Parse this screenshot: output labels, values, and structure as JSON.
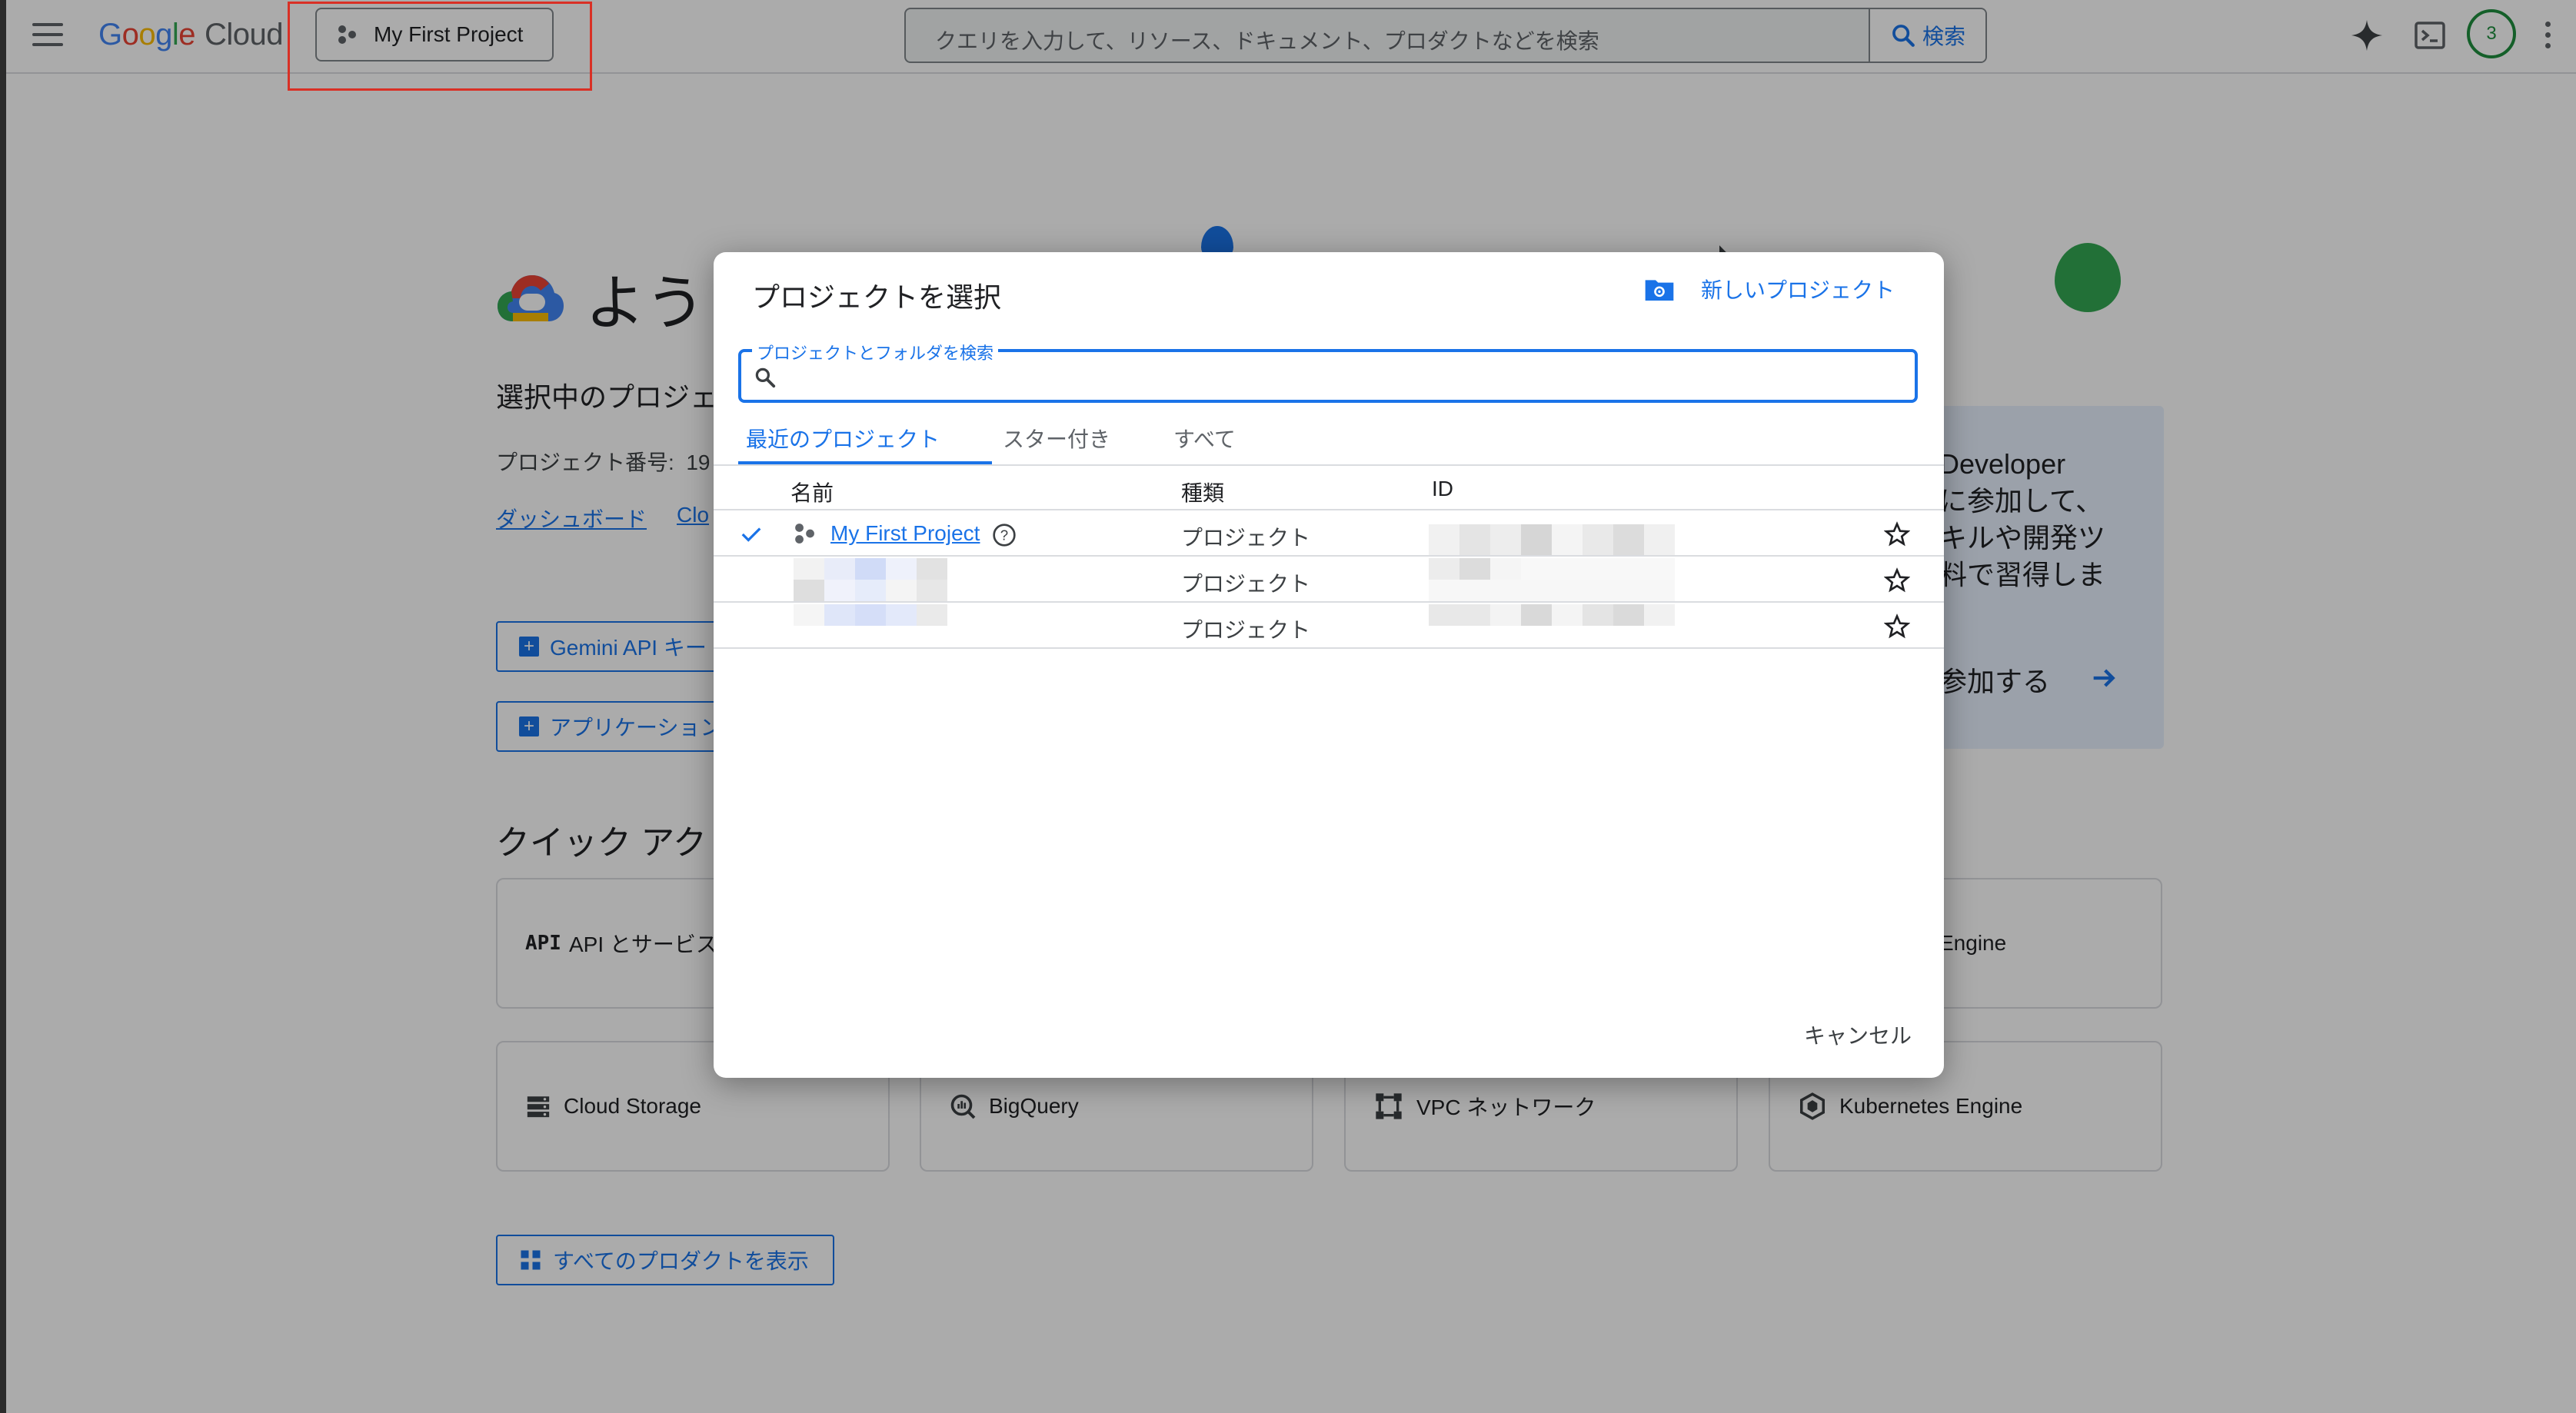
{
  "header": {
    "logo_parts": [
      "G",
      "o",
      "o",
      "g",
      "l",
      "e"
    ],
    "logo_cloud": "Cloud",
    "project_button": "My First Project",
    "search_placeholder": "クエリを入力して、リソース、ドキュメント、プロダクトなどを検索",
    "search_button": "検索",
    "avatar_badge": "3"
  },
  "background": {
    "welcome_title": "ようこ",
    "selected_project_label": "選択中のプロジェ",
    "project_number_label": "プロジェクト番号:",
    "project_number_value": "19",
    "dashboard_link": "ダッシュボード",
    "cloud_link": "Clo",
    "gemini_button": "Gemini API キー",
    "app_button": "アプリケーション",
    "quick_access_title": "クイック アク",
    "cards": [
      {
        "label": "API とサービス",
        "icon": "api-icon"
      },
      {
        "label": "Engine",
        "icon": ""
      },
      {
        "label": "Cloud Storage",
        "icon": "storage-icon"
      },
      {
        "label": "BigQuery",
        "icon": "bigquery-icon"
      },
      {
        "label": "VPC ネットワーク",
        "icon": "vpc-icon"
      },
      {
        "label": "Kubernetes Engine",
        "icon": "kubernetes-icon"
      }
    ],
    "api_icon_text": "API",
    "view_all_products": "すべてのプロダクトを表示",
    "promo_text": "Developer\nに参加して、\nキルや開発ツ\n料で習得しま",
    "promo_join": "参加する"
  },
  "dialog": {
    "title": "プロジェクトを選択",
    "new_project": "新しいプロジェクト",
    "search_label": "プロジェクトとフォルダを検索",
    "search_value": "",
    "tabs": [
      "最近のプロジェクト",
      "スター付き",
      "すべて"
    ],
    "active_tab": 0,
    "columns": [
      "名前",
      "種類",
      "ID"
    ],
    "rows": [
      {
        "name": "My First Project",
        "type": "プロジェクト",
        "selected": true
      },
      {
        "name": "",
        "type": "プロジェクト",
        "selected": false
      },
      {
        "name": "",
        "type": "プロジェクト",
        "selected": false
      }
    ],
    "cancel": "キャンセル"
  },
  "colors": {
    "accent": "#1a73e8",
    "highlight": "#d93025",
    "avatar_ring": "#1e8e3e"
  }
}
